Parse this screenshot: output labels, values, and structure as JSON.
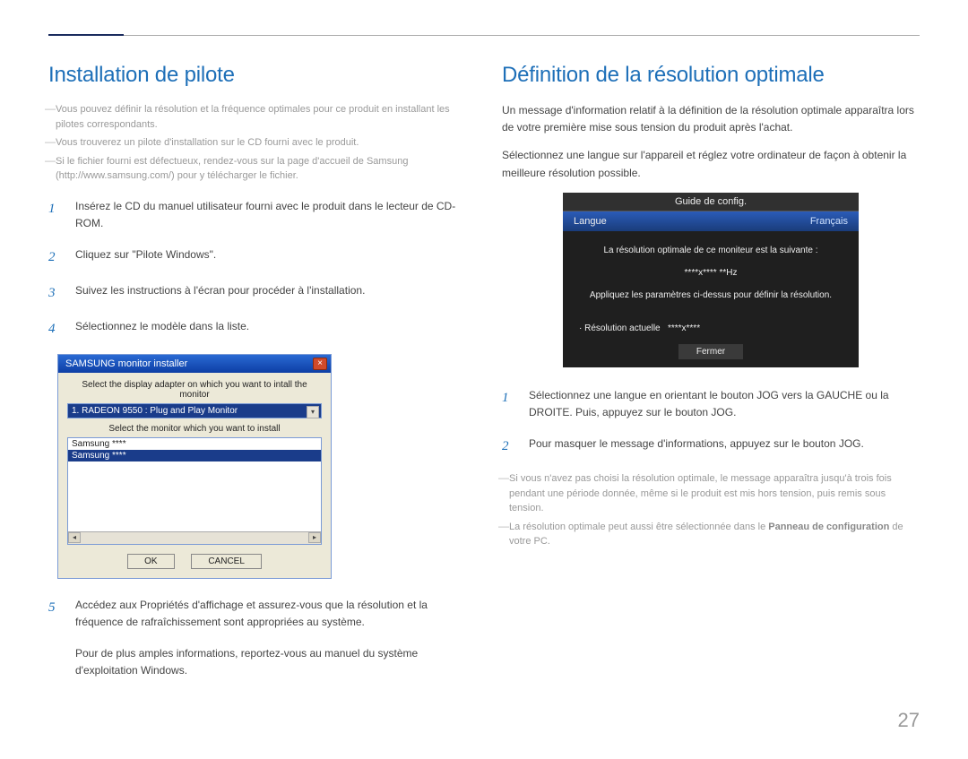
{
  "page_number": "27",
  "left": {
    "title": "Installation de pilote",
    "notes": [
      "Vous pouvez définir la résolution et la fréquence optimales pour ce produit en installant les pilotes correspondants.",
      "Vous trouverez un pilote d'installation sur le CD fourni avec le produit.",
      "Si le fichier fourni est défectueux, rendez-vous sur la page d'accueil de Samsung (http://www.samsung.com/) pour y télécharger le fichier."
    ],
    "steps": [
      "Insérez le CD du manuel utilisateur fourni avec le produit dans le lecteur de CD-ROM.",
      "Cliquez sur \"Pilote Windows\".",
      "Suivez les instructions à l'écran pour procéder à l'installation.",
      "Sélectionnez le modèle dans la liste."
    ],
    "dialog": {
      "title": "SAMSUNG monitor installer",
      "label_top": "Select the display adapter on which you want to intall the monitor",
      "adapter_selected": "1. RADEON 9550 : Plug and Play Monitor",
      "label_mid": "Select the monitor which you want to install",
      "monitor_item1": "Samsung ****",
      "monitor_item2": "Samsung ****",
      "ok": "OK",
      "cancel": "CANCEL"
    },
    "step5": "Accédez aux Propriétés d'affichage et assurez-vous que la résolution et la fréquence de rafraîchissement sont appropriées au système.",
    "closing": "Pour de plus amples informations, reportez-vous au manuel du système d'exploitation Windows."
  },
  "right": {
    "title": "Définition de la résolution optimale",
    "intro1": "Un message d'information relatif à la définition de la résolution optimale apparaîtra lors de votre première mise sous tension du produit après l'achat.",
    "intro2": "Sélectionnez une langue sur l'appareil et réglez votre ordinateur de façon à obtenir la meilleure résolution possible.",
    "osd": {
      "title": "Guide de config.",
      "lang_label": "Langue",
      "lang_value": "Français",
      "line1": "La résolution optimale de ce moniteur est la suivante :",
      "line2": "****x**** **Hz",
      "line3": "Appliquez les paramètres ci-dessus pour définir la résolution.",
      "res_actual_lbl": "· Résolution actuelle",
      "res_actual_val": "****x****",
      "close": "Fermer"
    },
    "steps": [
      "Sélectionnez une langue en orientant le bouton JOG vers la GAUCHE ou la DROITE. Puis, appuyez sur le bouton JOG.",
      "Pour masquer le message d'informations, appuyez sur le bouton JOG."
    ],
    "notes_bottom": [
      "Si vous n'avez pas choisi la résolution optimale, le message apparaîtra jusqu'à trois fois pendant une période donnée, même si le produit est mis hors tension, puis remis sous tension.",
      "La résolution optimale peut aussi être sélectionnée dans le Panneau de configuration de votre PC."
    ],
    "strong_phrase": "Panneau de configuration"
  }
}
